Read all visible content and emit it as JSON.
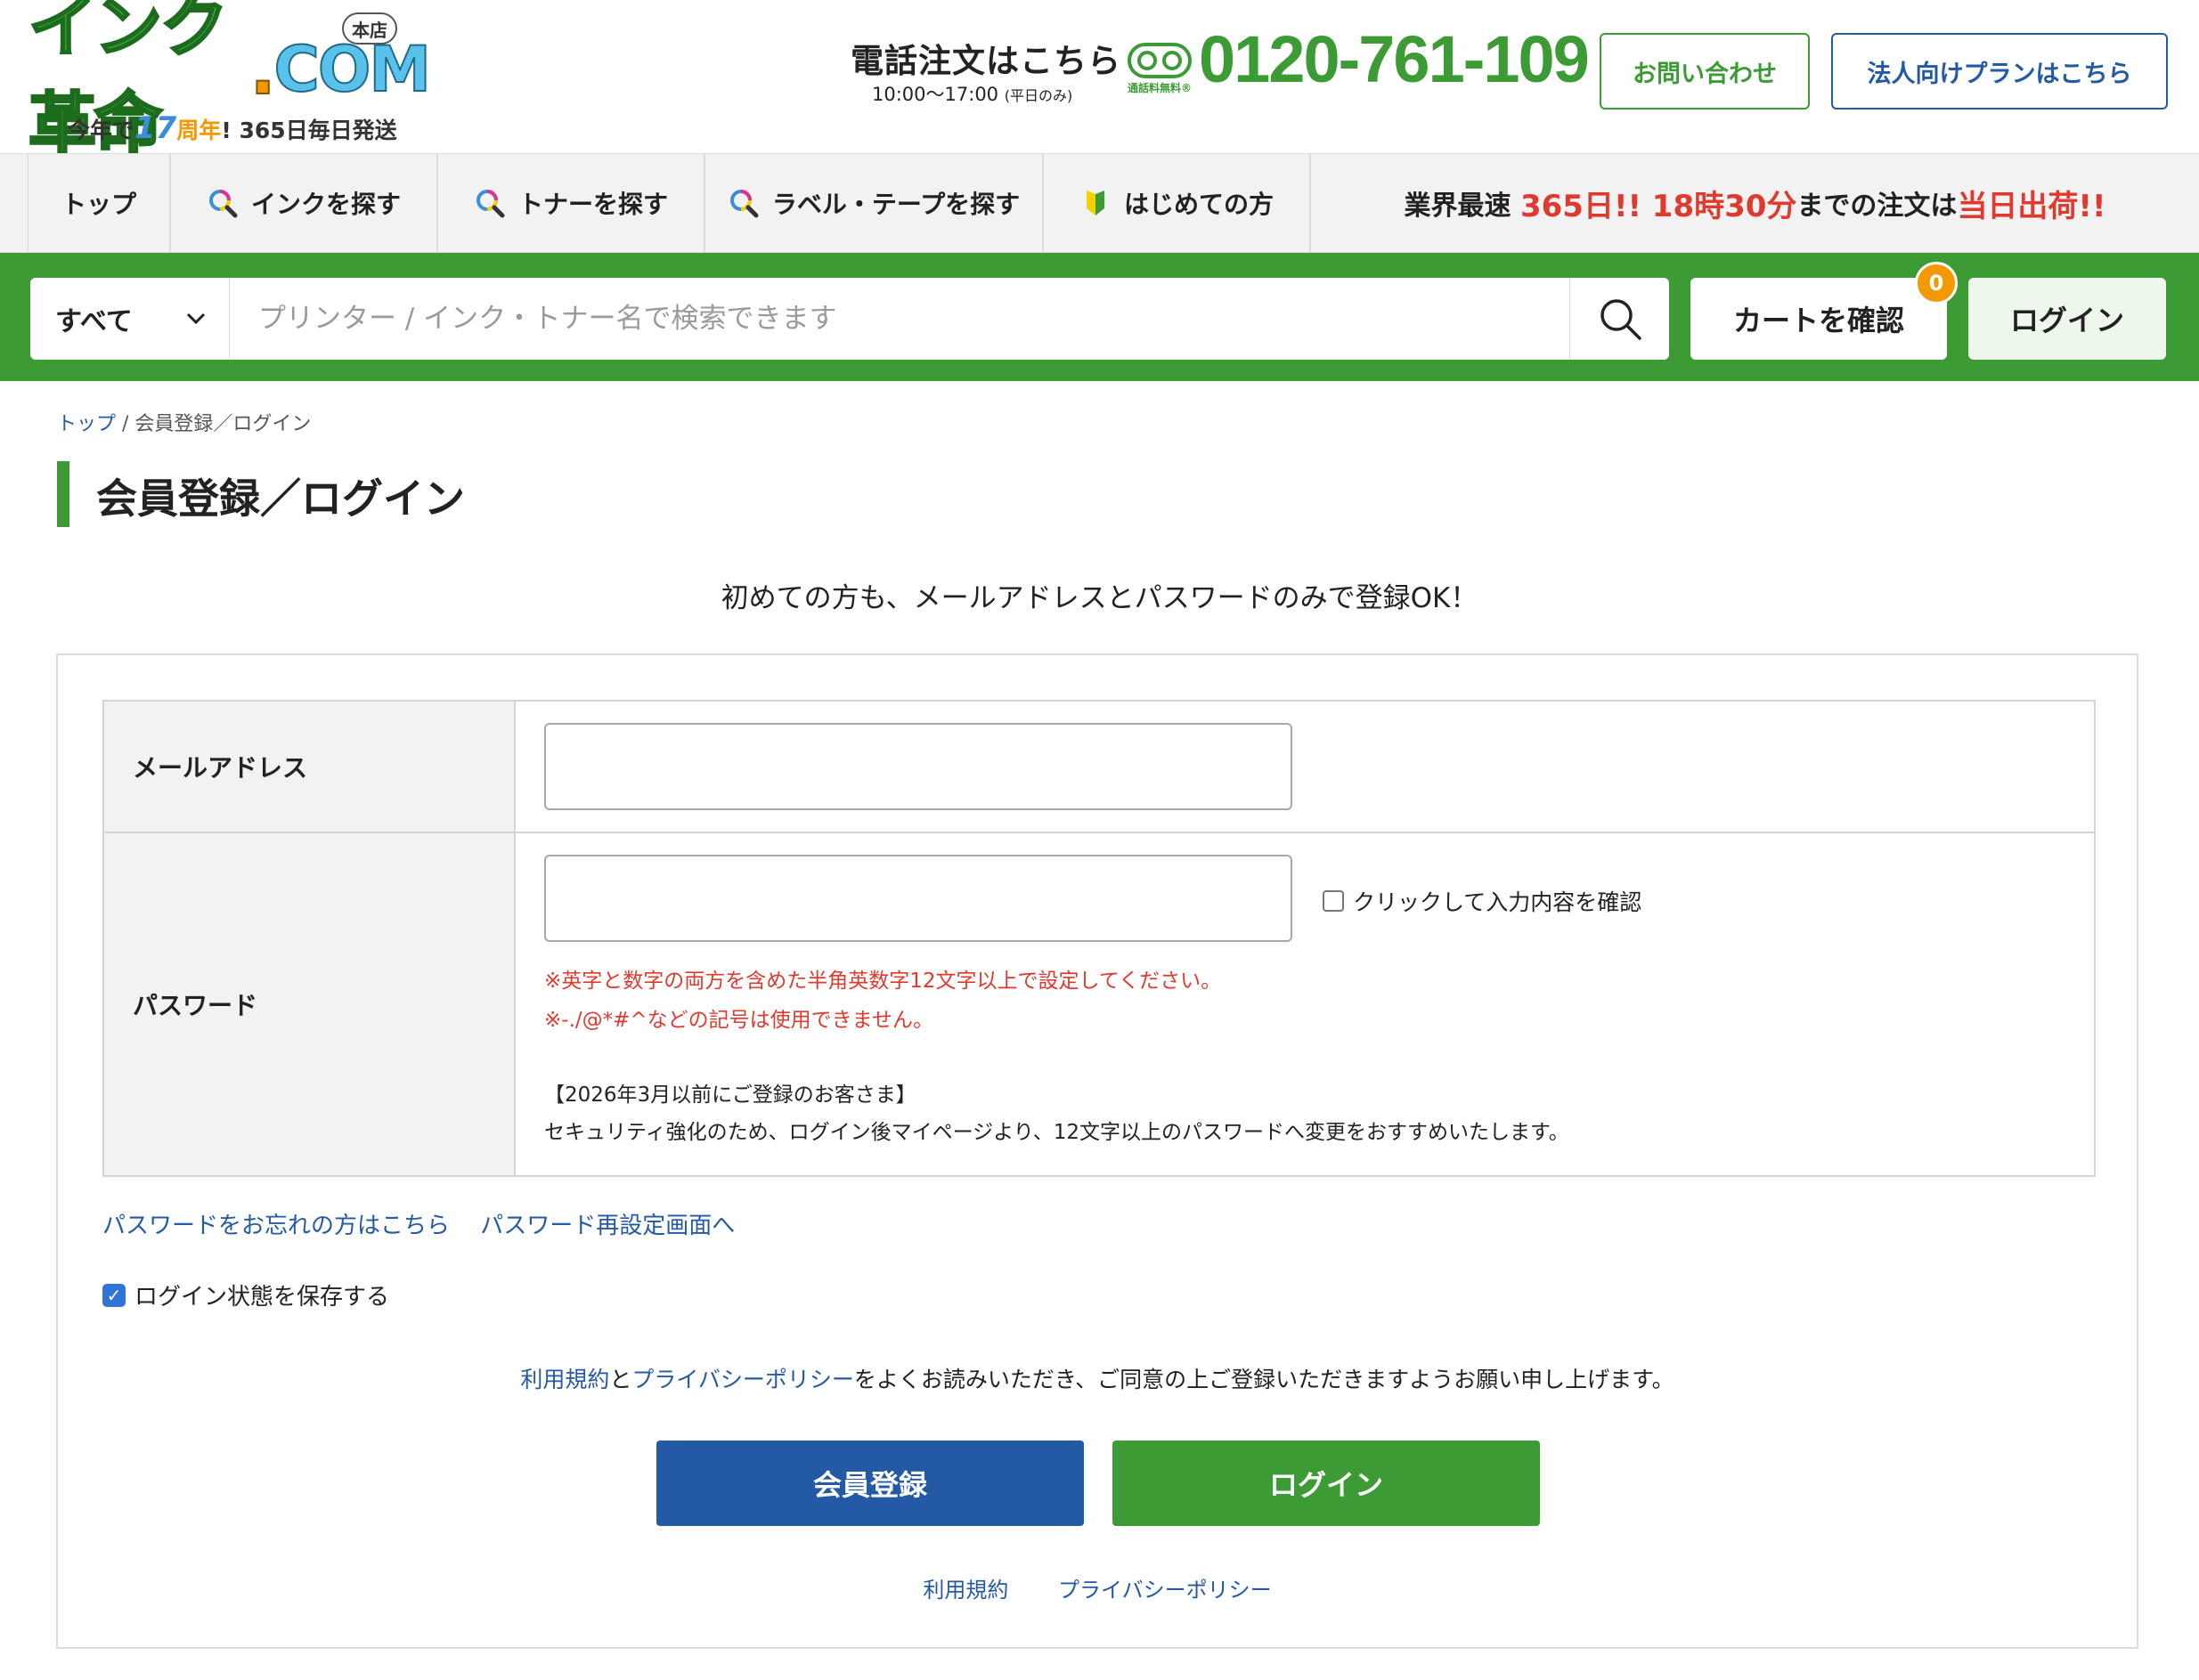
{
  "header": {
    "logo_text": "インク革命",
    "logo_dot": ".",
    "logo_com": "COM",
    "logo_badge": "本店",
    "tagline_pre": "今年で",
    "tagline_num": "17",
    "tagline_anniv": "周年",
    "tagline_post": "! 365日毎日発送",
    "tel_label": "電話注文はこちら",
    "tel_hours": "10:00～17:00",
    "tel_hours_note": "(平日のみ)",
    "freedial_text": "通話料無料®",
    "tel_number": "0120-761-109",
    "contact_label": "お問い合わせ",
    "corp_label": "法人向けプランはこちら"
  },
  "nav": {
    "items": [
      {
        "label": "トップ"
      },
      {
        "label": "インクを探す"
      },
      {
        "label": "トナーを探す"
      },
      {
        "label": "ラベル・テープを探す"
      },
      {
        "label": "はじめての方"
      }
    ],
    "promo_a": "業界最速 ",
    "promo_b": "365日!! 18時30分",
    "promo_c": "までの注文は",
    "promo_d": "当日出荷!!"
  },
  "search": {
    "category": "すべて",
    "placeholder": "プリンター / インク・トナー名で検索できます",
    "cart_label": "カートを確認",
    "cart_count": "0",
    "login_label": "ログイン"
  },
  "breadcrumb": {
    "home": "トップ",
    "sep": " / ",
    "current": "会員登録／ログイン"
  },
  "page": {
    "title": "会員登録／ログイン",
    "intro": "初めての方も、メールアドレスとパスワードのみで登録OK！"
  },
  "form": {
    "email_label": "メールアドレス",
    "email_value": "",
    "password_label": "パスワード",
    "password_value": "",
    "show_password_label": "クリックして入力内容を確認",
    "note_red_1": "※英字と数字の両方を含めた半角英数字12文字以上で設定してください。",
    "note_red_2": "※-./@*#^などの記号は使用できません。",
    "note_3": "【2026年3月以前にご登録のお客さま】",
    "note_4": "セキュリティ強化のため、ログイン後マイページより、12文字以上のパスワードへ変更をおすすめいたします。",
    "forgot_link": "パスワードをお忘れの方はこちら",
    "reset_link": "パスワード再設定画面へ",
    "remember_label": "ログイン状態を保存する",
    "remember_checked": true,
    "consent_terms": "利用規約",
    "consent_and": "と",
    "consent_privacy": "プライバシーポリシー",
    "consent_rest": "をよくお読みいただき、ご同意の上ご登録いただきますようお願い申し上げます。",
    "register_button": "会員登録",
    "login_button": "ログイン",
    "footer_terms": "利用規約",
    "footer_privacy": "プライバシーポリシー"
  },
  "colors": {
    "brand_green": "#3d9b35",
    "brand_blue": "#245aa5",
    "accent_red": "#e03a2f",
    "badge_orange": "#f39800"
  }
}
